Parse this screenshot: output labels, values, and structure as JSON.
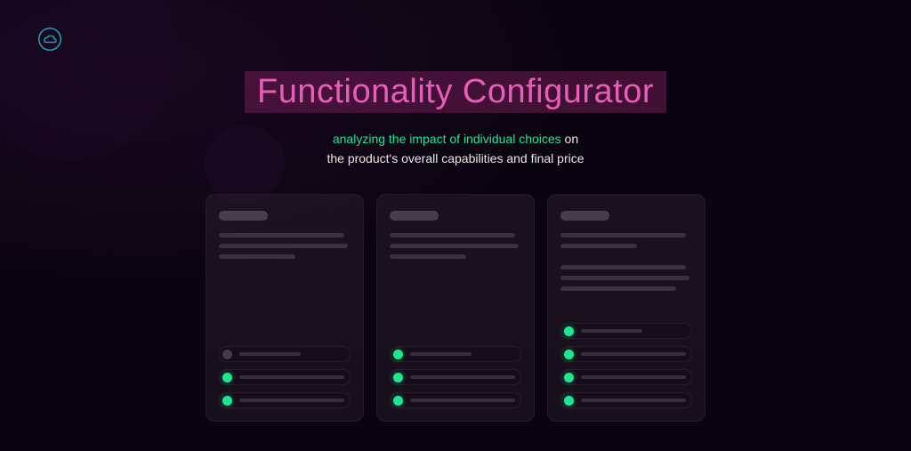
{
  "hero": {
    "title": "Functionality Configurator",
    "subtitle_highlight": "analyzing the impact of individual choices",
    "subtitle_rest_1": " on",
    "subtitle_line2": "the product's overall capabilities and final price"
  },
  "cards": [
    {
      "text_blocks": [
        [
          "w1",
          "w2",
          "w3"
        ]
      ],
      "options": [
        {
          "selected": false,
          "width": "short"
        },
        {
          "selected": true,
          "width": "full"
        },
        {
          "selected": true,
          "width": "full"
        }
      ]
    },
    {
      "text_blocks": [
        [
          "w1",
          "w2",
          "w3"
        ]
      ],
      "options": [
        {
          "selected": true,
          "width": "short"
        },
        {
          "selected": true,
          "width": "full"
        },
        {
          "selected": true,
          "width": "full"
        }
      ]
    },
    {
      "text_blocks": [
        [
          "w1",
          "w3"
        ],
        [
          "w1",
          "w2",
          "w4"
        ]
      ],
      "options": [
        {
          "selected": true,
          "width": "short"
        },
        {
          "selected": true,
          "width": "full"
        },
        {
          "selected": true,
          "width": "full"
        },
        {
          "selected": true,
          "width": "full"
        }
      ]
    }
  ],
  "colors": {
    "accent_pink": "#e85db8",
    "accent_green": "#1ce88c",
    "bg": "#0a0410"
  }
}
